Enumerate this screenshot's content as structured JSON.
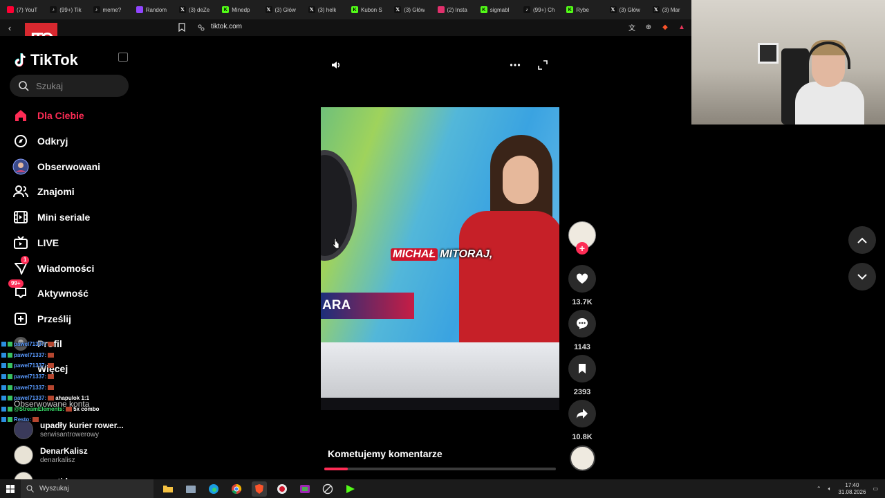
{
  "browser": {
    "tabs": [
      {
        "label": "(7) YouT",
        "icon": "youtube-icon",
        "color": "#ff0033"
      },
      {
        "label": "(99+) Tik",
        "icon": "tiktok-icon",
        "color": "#111111"
      },
      {
        "label": "meme?",
        "icon": "tiktok-icon",
        "color": "#111111"
      },
      {
        "label": "Random",
        "icon": "twitch-icon",
        "color": "#9146ff"
      },
      {
        "label": "(3) deZe",
        "icon": "x-icon",
        "color": "#111111"
      },
      {
        "label": "Minedp",
        "icon": "kick-icon",
        "color": "#53fc18"
      },
      {
        "label": "(3) Głów",
        "icon": "x-icon",
        "color": "#111111"
      },
      {
        "label": "(3) helk",
        "icon": "x-icon",
        "color": "#111111"
      },
      {
        "label": "Kubon S",
        "icon": "kick-icon",
        "color": "#53fc18"
      },
      {
        "label": "(3) Głów",
        "icon": "x-icon",
        "color": "#111111"
      },
      {
        "label": "(2) Insta",
        "icon": "instagram-icon",
        "color": "#e1306c"
      },
      {
        "label": "sigmabl",
        "icon": "kick-icon",
        "color": "#53fc18"
      },
      {
        "label": "(99+) Ch",
        "icon": "tiktok-icon",
        "color": "#111111"
      },
      {
        "label": "Rybe",
        "icon": "kick-icon",
        "color": "#53fc18"
      },
      {
        "label": "(3) Głów",
        "icon": "x-icon",
        "color": "#111111"
      },
      {
        "label": "(3) Mar",
        "icon": "x-icon",
        "color": "#111111"
      }
    ],
    "url": "tiktok.com"
  },
  "overlay": {
    "logo_text": "ITO"
  },
  "sidebar": {
    "logo": "TikTok",
    "search_placeholder": "Szukaj",
    "items": [
      {
        "label": "Dla Ciebie",
        "icon": "home-icon",
        "active": true
      },
      {
        "label": "Odkryj",
        "icon": "compass-icon"
      },
      {
        "label": "Obserwowani",
        "icon": "avatar-icon"
      },
      {
        "label": "Znajomi",
        "icon": "friends-icon"
      },
      {
        "label": "Mini seriale",
        "icon": "film-icon"
      },
      {
        "label": "LIVE",
        "icon": "tv-icon"
      },
      {
        "label": "Wiadomości",
        "icon": "send-icon",
        "badge": "1"
      },
      {
        "label": "Aktywność",
        "icon": "inbox-icon",
        "badge": "99+"
      },
      {
        "label": "Prześlij",
        "icon": "upload-icon"
      },
      {
        "label": "Profil",
        "icon": "profile-icon"
      },
      {
        "label": "Więcej",
        "icon": "more-icon"
      }
    ],
    "followed_title": "Obserwowane konta",
    "followed": [
      {
        "name": "upadły kurier rower...",
        "handle": "serwisantrowerowy"
      },
      {
        "name": "DenarKalisz",
        "handle": "denarkalisz"
      },
      {
        "name": "cryptid",
        "handle": ""
      }
    ]
  },
  "chat": [
    {
      "user": "pawel71337:",
      "msg": ""
    },
    {
      "user": "pawel71337:",
      "msg": ""
    },
    {
      "user": "pawel71337:",
      "msg": ""
    },
    {
      "user": "pawel71337:",
      "msg": ""
    },
    {
      "user": "pawel71337:",
      "msg": ""
    },
    {
      "user": "pawel71337:",
      "msg": "ahapulok 1:1"
    },
    {
      "user": "@StreamElements:",
      "msg": "5x combo",
      "green": true
    },
    {
      "user": "Resto:",
      "msg": ""
    }
  ],
  "video": {
    "caption_highlight": "MICHAŁ",
    "caption_rest": "MITORAJ,",
    "lower_third": "ARA",
    "description": "Kometujemy komentarze",
    "progress": 0.1
  },
  "actions": {
    "likes": "13.7K",
    "comments": "1143",
    "saves": "2393",
    "shares": "10.8K"
  },
  "taskbar": {
    "search_placeholder": "Wyszukaj",
    "time": "17:40",
    "date": "31.08.2026"
  },
  "colors": {
    "accent": "#fe2c55",
    "background": "#000000"
  }
}
